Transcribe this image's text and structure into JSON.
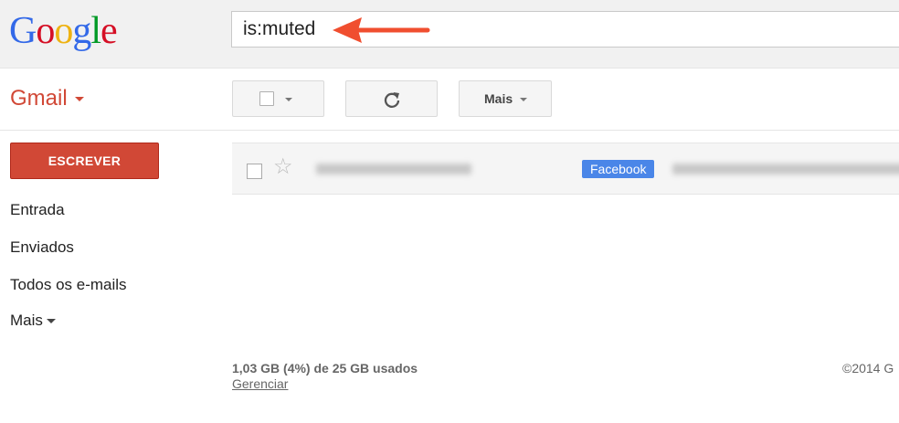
{
  "header": {
    "logo_letters": [
      {
        "char": "G",
        "color": "#3369e8"
      },
      {
        "char": "o",
        "color": "#d50f25"
      },
      {
        "char": "o",
        "color": "#eeb211"
      },
      {
        "char": "g",
        "color": "#3369e8"
      },
      {
        "char": "l",
        "color": "#009925"
      },
      {
        "char": "e",
        "color": "#d50f25"
      }
    ],
    "search_value": "is:muted",
    "annotation_arrow_color": "#f04e2f"
  },
  "app": {
    "name": "Gmail",
    "accent_color": "#d14836"
  },
  "toolbar": {
    "select_icon": "checkbox-icon",
    "refresh_icon": "refresh-icon",
    "more_label": "Mais"
  },
  "sidebar": {
    "compose_label": "ESCREVER",
    "items": [
      {
        "label": "Entrada"
      },
      {
        "label": "Enviados"
      },
      {
        "label": "Todos os e-mails"
      },
      {
        "label": "Mais"
      }
    ]
  },
  "messages": [
    {
      "sender": "",
      "label": "Facebook",
      "label_color": "#4a86e8",
      "subject": ""
    }
  ],
  "footer": {
    "storage": "1,03 GB (4%) de 25 GB usados",
    "manage": "Gerenciar",
    "copyright": "©2014 G"
  }
}
